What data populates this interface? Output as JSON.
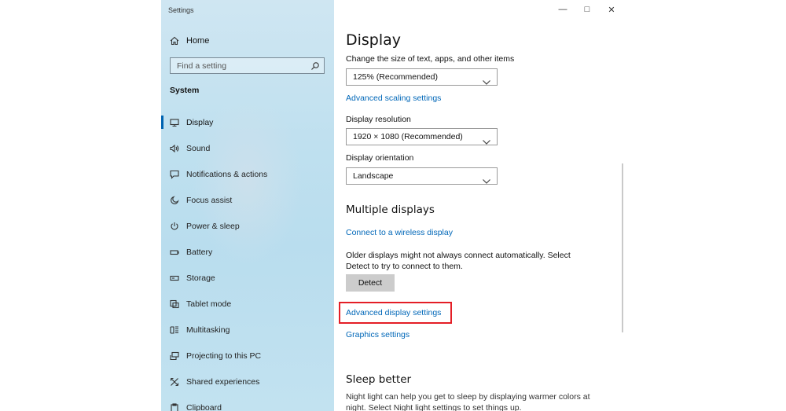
{
  "window": {
    "title": "Settings"
  },
  "sidebar": {
    "home_label": "Home",
    "search_placeholder": "Find a setting",
    "section_title": "System",
    "items": [
      {
        "label": "Display",
        "icon": "monitor-icon",
        "selected": true
      },
      {
        "label": "Sound",
        "icon": "speaker-icon"
      },
      {
        "label": "Notifications & actions",
        "icon": "message-icon"
      },
      {
        "label": "Focus assist",
        "icon": "moon-icon"
      },
      {
        "label": "Power & sleep",
        "icon": "power-icon"
      },
      {
        "label": "Battery",
        "icon": "battery-icon"
      },
      {
        "label": "Storage",
        "icon": "storage-icon"
      },
      {
        "label": "Tablet mode",
        "icon": "tablet-icon"
      },
      {
        "label": "Multitasking",
        "icon": "multitasking-icon"
      },
      {
        "label": "Projecting to this PC",
        "icon": "projector-icon"
      },
      {
        "label": "Shared experiences",
        "icon": "shared-icon"
      },
      {
        "label": "Clipboard",
        "icon": "clipboard-icon"
      }
    ]
  },
  "content": {
    "title": "Display",
    "scale_label": "Change the size of text, apps, and other items",
    "scale_value": "125% (Recommended)",
    "advanced_scaling_link": "Advanced scaling settings",
    "resolution_label": "Display resolution",
    "resolution_value": "1920 × 1080 (Recommended)",
    "orientation_label": "Display orientation",
    "orientation_value": "Landscape",
    "multiple_displays_heading": "Multiple displays",
    "wireless_link": "Connect to a wireless display",
    "older_displays_line1": "Older displays might not always connect automatically. Select",
    "older_displays_line2": "Detect to try to connect to them.",
    "detect_button": "Detect",
    "advanced_display_link": "Advanced display settings",
    "graphics_link": "Graphics settings",
    "sleep_heading": "Sleep better",
    "sleep_line1": "Night light can help you get to sleep by displaying warmer colors at",
    "sleep_line2": "night. Select Night light settings to set things up."
  },
  "colors": {
    "accent": "#0063b1",
    "link": "#0067b8",
    "highlight": "#e41e26",
    "sidebar": "#bfe0ef"
  }
}
